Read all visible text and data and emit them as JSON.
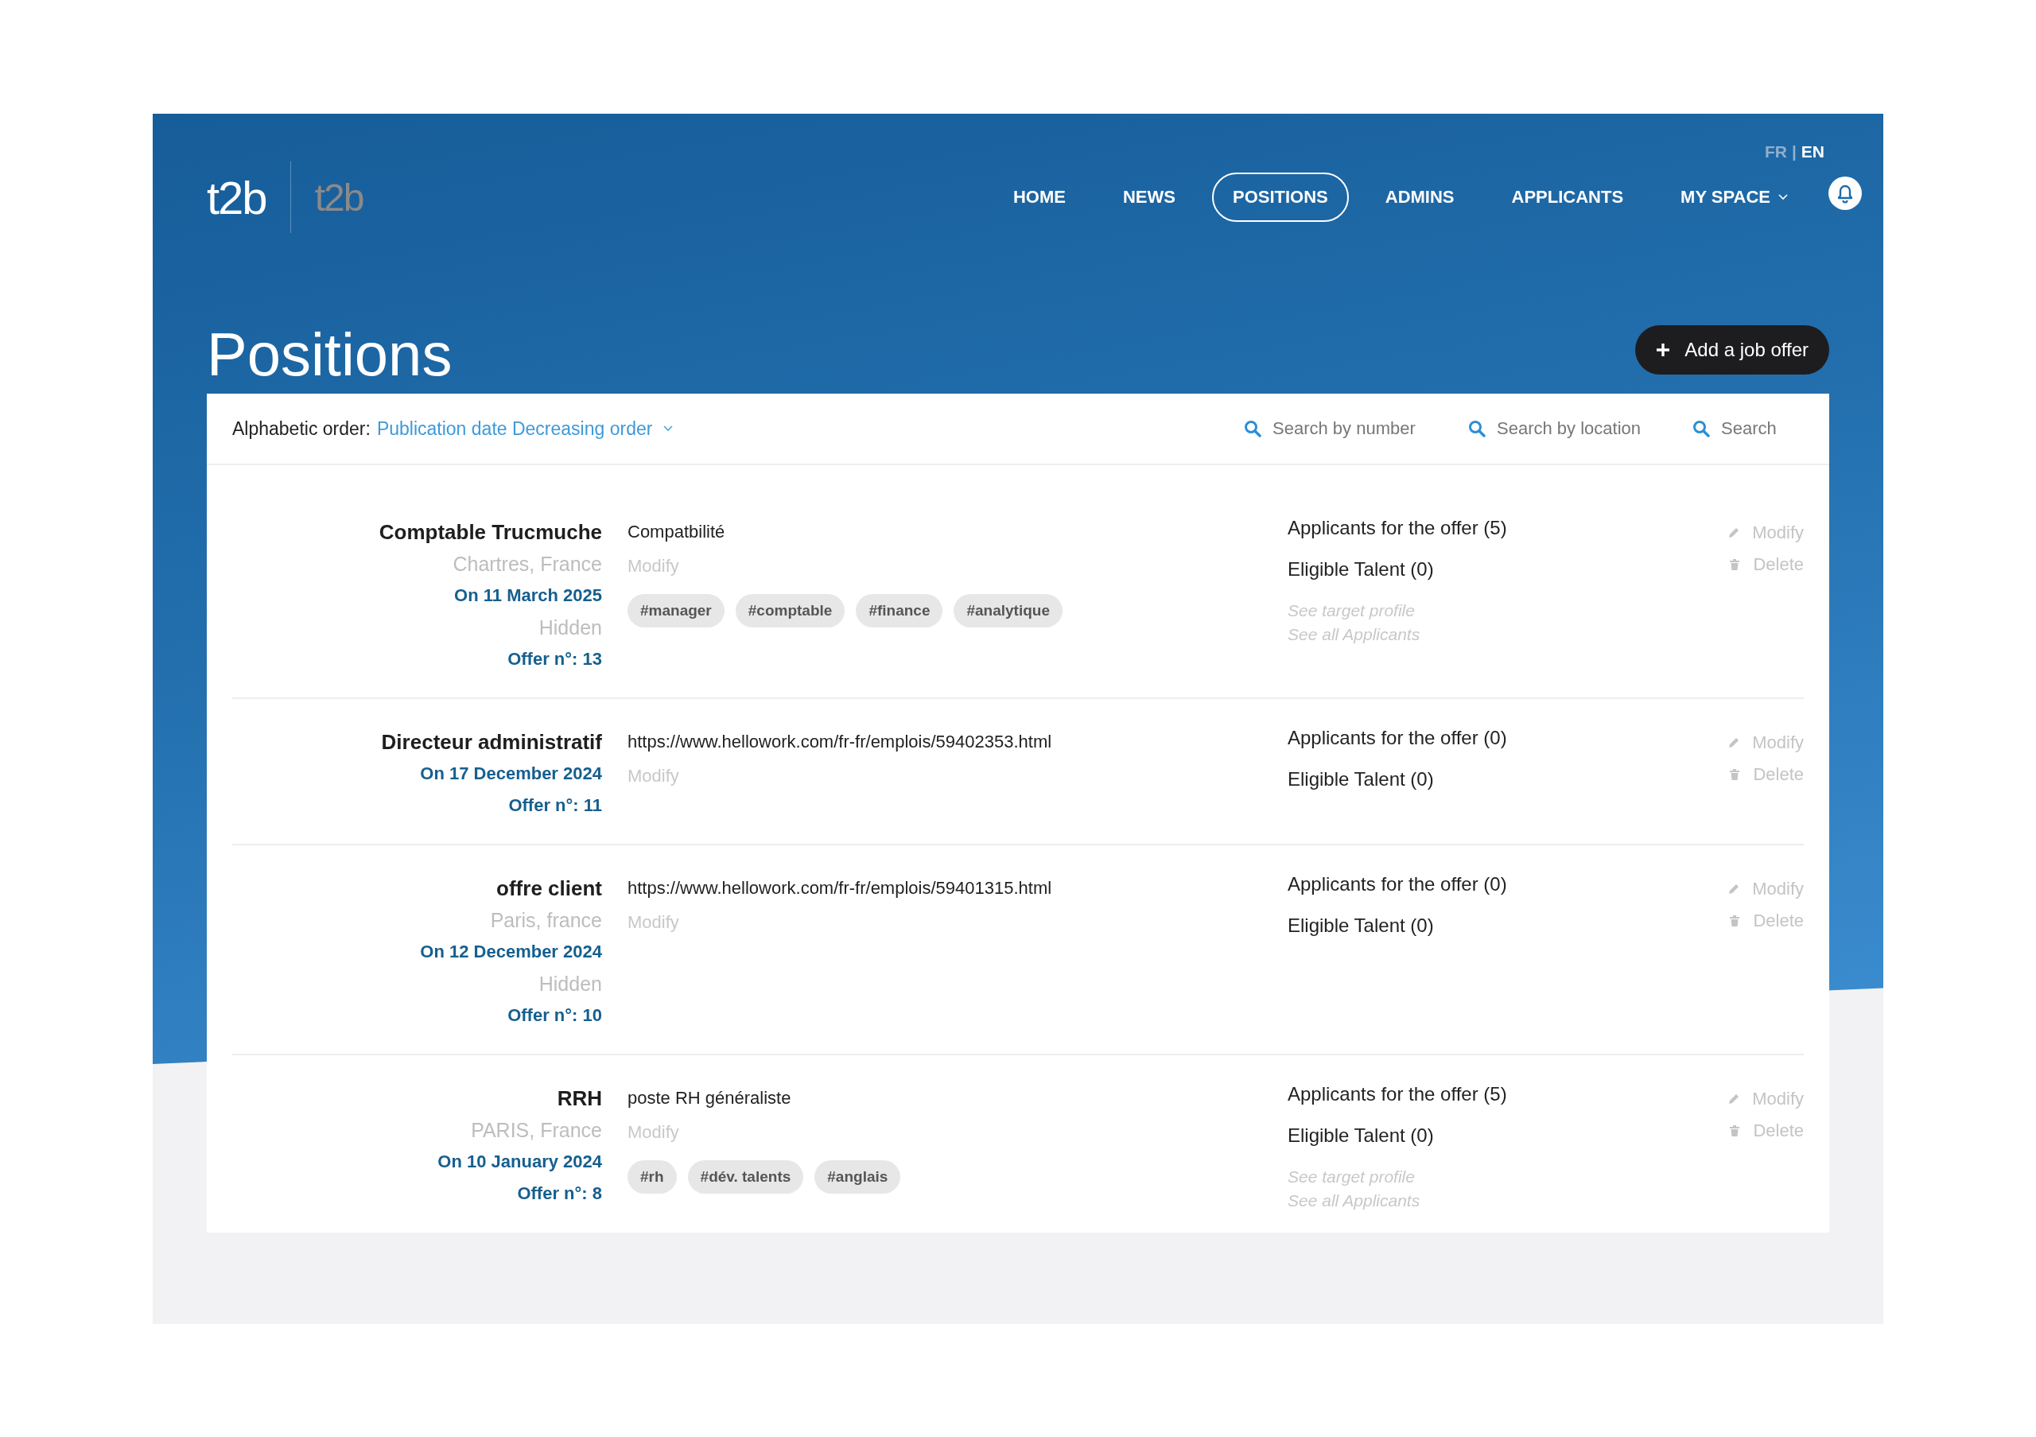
{
  "logos": [
    {
      "text": "t2b",
      "dimmed": false
    },
    {
      "text": "t2b",
      "dimmed": true
    }
  ],
  "languages": [
    {
      "label": "FR",
      "selected": false
    },
    {
      "label": "EN",
      "selected": true
    }
  ],
  "language_separator": "|",
  "nav": [
    {
      "label": "HOME",
      "selected": false,
      "dropdown": false
    },
    {
      "label": "NEWS",
      "selected": false,
      "dropdown": false
    },
    {
      "label": "POSITIONS",
      "selected": true,
      "dropdown": false
    },
    {
      "label": "ADMINS",
      "selected": false,
      "dropdown": false
    },
    {
      "label": "APPLICANTS",
      "selected": false,
      "dropdown": false
    },
    {
      "label": "MY SPACE",
      "selected": false,
      "dropdown": true
    }
  ],
  "page_title": "Positions",
  "add_button": "Add a job offer",
  "filter": {
    "label": "Alphabetic order:",
    "value": "Publication date Decreasing order"
  },
  "search_fields": [
    {
      "placeholder": "Search by number"
    },
    {
      "placeholder": "Search by location"
    },
    {
      "placeholder": "Search"
    }
  ],
  "positions": [
    {
      "title": "Comptable Trucmuche",
      "location": "Chartres, France",
      "date": "On 11 March 2025",
      "visibility": "Hidden",
      "offer_number": "Offer n°: 13",
      "description": "Compatbilité",
      "modify": "Modify",
      "tags": [
        "#manager",
        "#comptable",
        "#finance",
        "#analytique"
      ],
      "applicants": "Applicants for the offer (5)",
      "eligible": "Eligible Talent (0)",
      "links": [
        "See target profile",
        "See all Applicants"
      ],
      "actions": [
        {
          "kind": "edit",
          "label": "Modify"
        },
        {
          "kind": "delete",
          "label": "Delete"
        }
      ]
    },
    {
      "title": "Directeur administratif",
      "date": "On 17 December 2024",
      "offer_number": "Offer n°: 11",
      "description": "https://www.hellowork.com/fr-fr/emplois/59402353.html",
      "modify": "Modify",
      "applicants": "Applicants for the offer (0)",
      "eligible": "Eligible Talent (0)",
      "actions": [
        {
          "kind": "edit",
          "label": "Modify"
        },
        {
          "kind": "delete",
          "label": "Delete"
        }
      ]
    },
    {
      "title": "offre client",
      "location": "Paris, france",
      "date": "On 12 December 2024",
      "visibility": "Hidden",
      "offer_number": "Offer n°: 10",
      "description": "https://www.hellowork.com/fr-fr/emplois/59401315.html",
      "modify": "Modify",
      "applicants": "Applicants for the offer (0)",
      "eligible": "Eligible Talent (0)",
      "actions": [
        {
          "kind": "edit",
          "label": "Modify"
        },
        {
          "kind": "delete",
          "label": "Delete"
        }
      ]
    },
    {
      "title": "RRH",
      "location": "PARIS, France",
      "date": "On 10 January 2024",
      "offer_number": "Offer n°: 8",
      "description": "poste RH généraliste",
      "modify": "Modify",
      "tags": [
        "#rh",
        "#dév. talents",
        "#anglais"
      ],
      "applicants": "Applicants for the offer (5)",
      "eligible": "Eligible Talent (0)",
      "links": [
        "See target profile",
        "See all Applicants"
      ],
      "actions": [
        {
          "kind": "edit",
          "label": "Modify"
        },
        {
          "kind": "delete",
          "label": "Delete"
        }
      ]
    }
  ]
}
